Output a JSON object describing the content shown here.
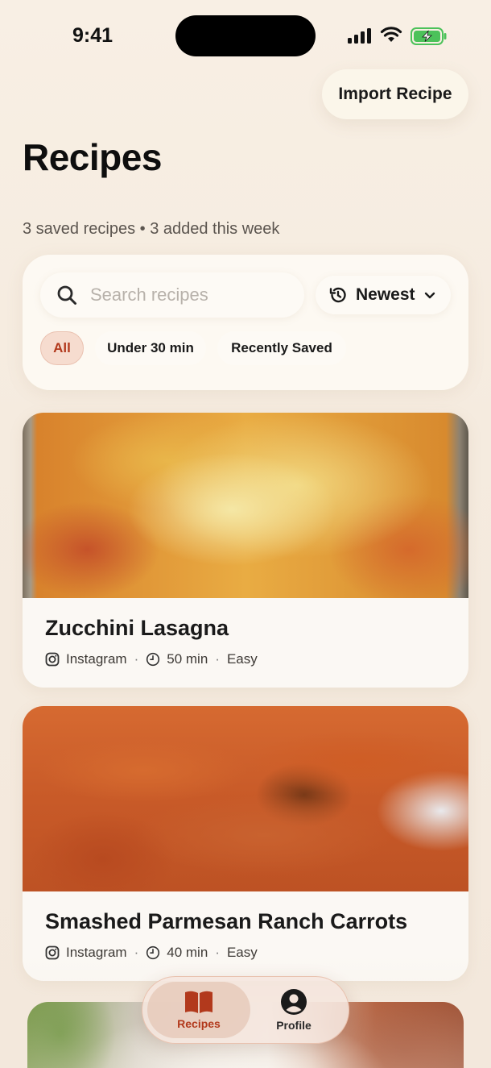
{
  "status_bar": {
    "time": "9:41"
  },
  "header": {
    "import_label": "Import Recipe",
    "title": "Recipes",
    "subtitle": "3 saved recipes • 3 added this week"
  },
  "search": {
    "placeholder": "Search recipes",
    "value": ""
  },
  "sort": {
    "label": "Newest"
  },
  "filters": [
    {
      "label": "All",
      "active": true
    },
    {
      "label": "Under 30 min",
      "active": false
    },
    {
      "label": "Recently Saved",
      "active": false
    }
  ],
  "recipes": [
    {
      "title": "Zucchini Lasagna",
      "source": "Instagram",
      "time": "50 min",
      "difficulty": "Easy",
      "sep": "·"
    },
    {
      "title": "Smashed Parmesan Ranch Carrots",
      "source": "Instagram",
      "time": "40 min",
      "difficulty": "Easy",
      "sep": "·"
    }
  ],
  "tabs": [
    {
      "label": "Recipes",
      "icon": "book-icon",
      "active": true
    },
    {
      "label": "Profile",
      "icon": "person-icon",
      "active": false
    }
  ],
  "colors": {
    "accent": "#b2391c",
    "chip_active_bg": "#f6dccf",
    "background": "#f8efe4"
  }
}
